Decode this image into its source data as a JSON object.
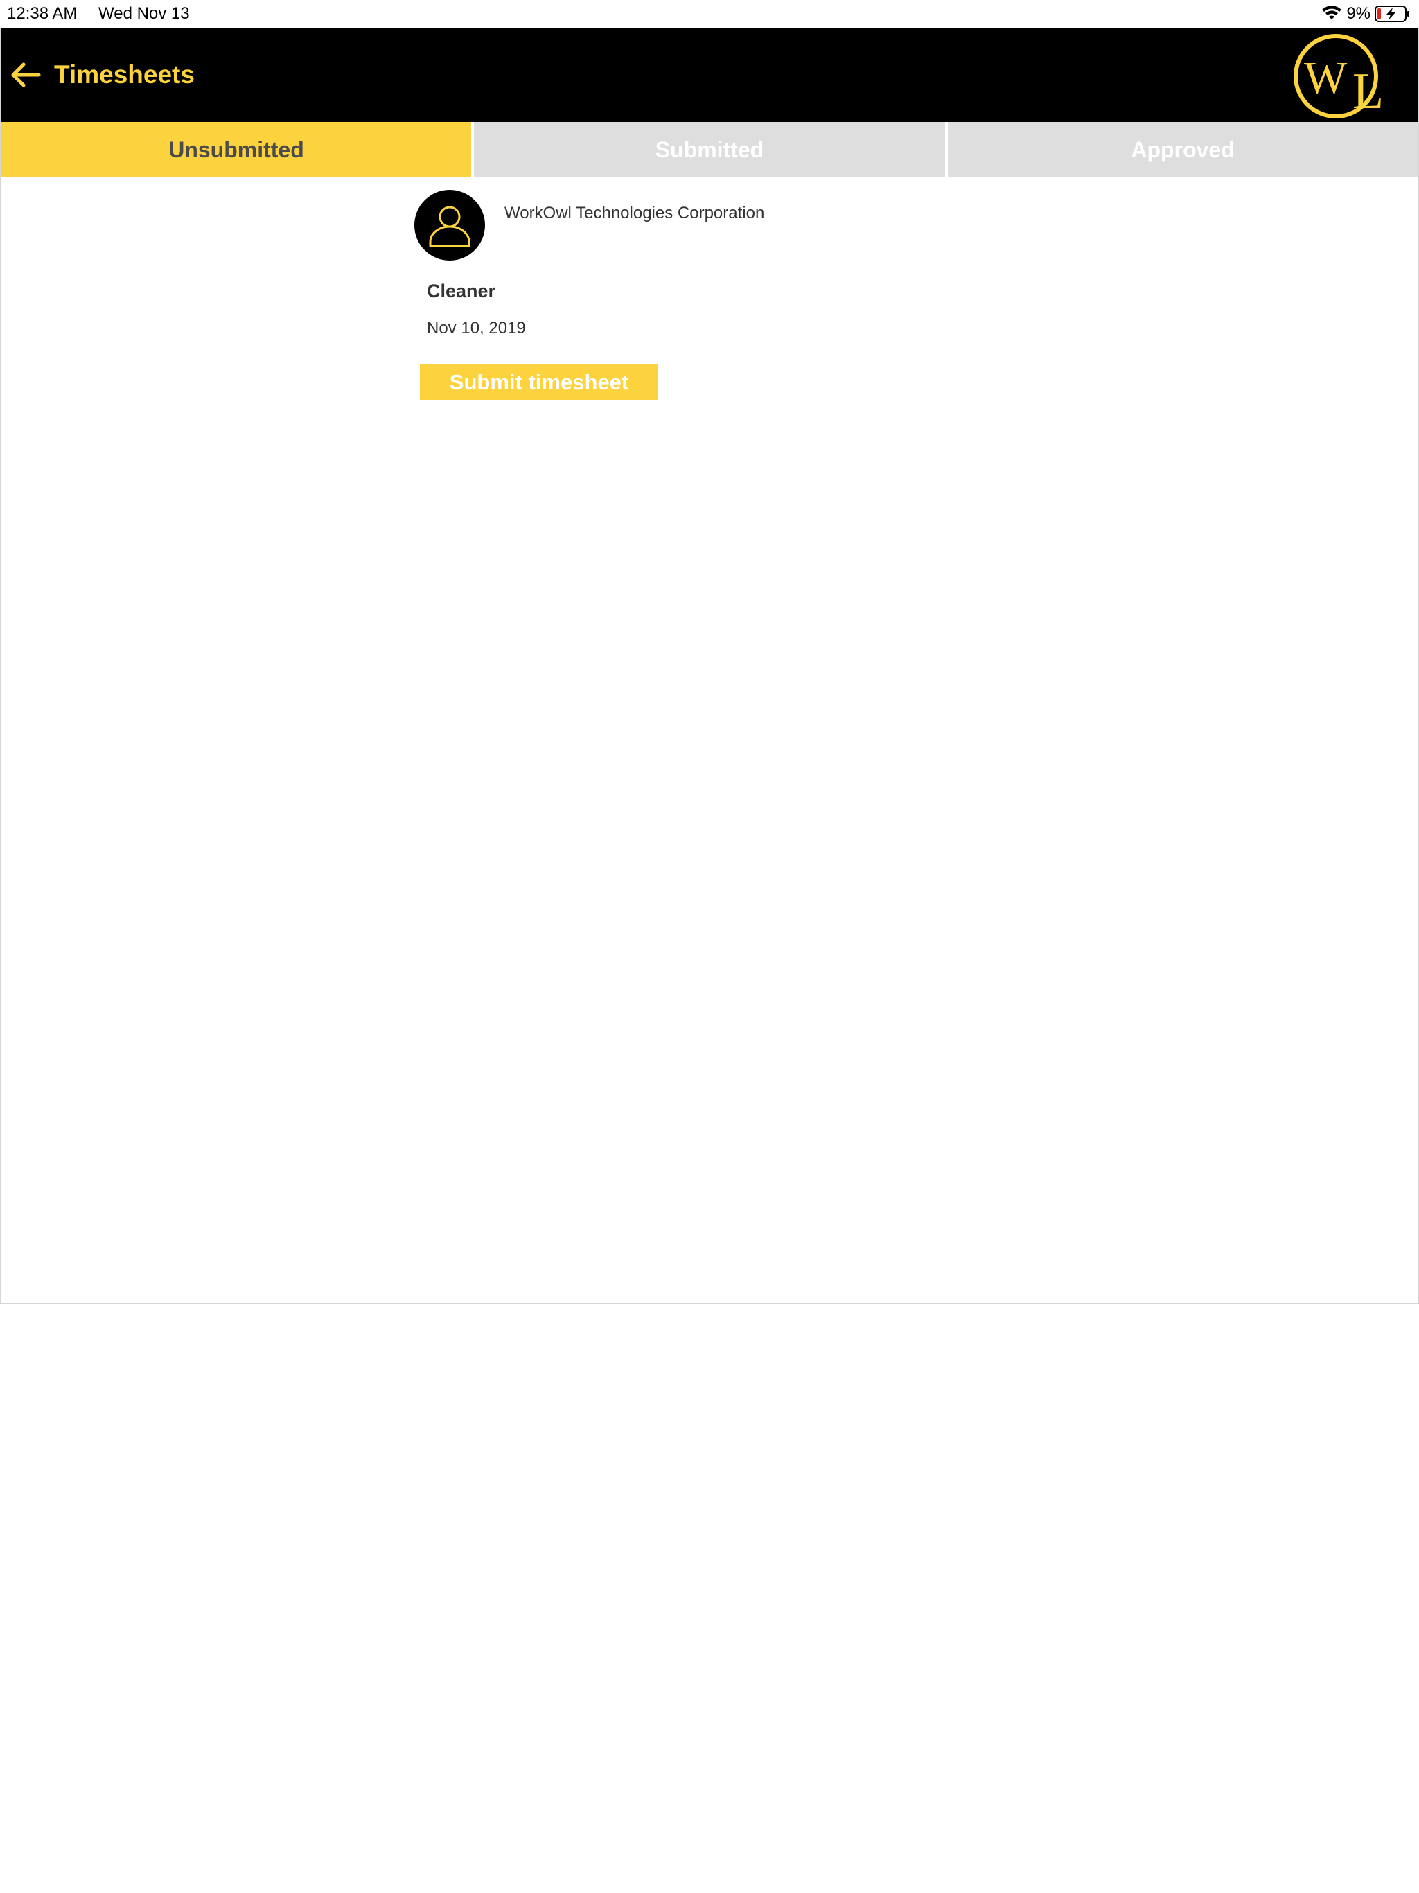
{
  "status_bar": {
    "time": "12:38 AM",
    "date": "Wed Nov 13",
    "battery_percent": "9%"
  },
  "header": {
    "title": "Timesheets",
    "back_icon": "arrow-left-icon",
    "logo_icon": "workowl-wl-logo"
  },
  "tabs": [
    {
      "label": "Unsubmitted",
      "active": true
    },
    {
      "label": "Submitted",
      "active": false
    },
    {
      "label": "Approved",
      "active": false
    }
  ],
  "timesheet": {
    "company": "WorkOwl Technologies Corporation",
    "role": "Cleaner",
    "date": "Nov 10, 2019",
    "submit_label": "Submit timesheet",
    "avatar_icon": "user-icon"
  },
  "colors": {
    "brand_yellow": "#fcd33f",
    "header_black": "#000000",
    "tab_inactive": "#dedede"
  }
}
